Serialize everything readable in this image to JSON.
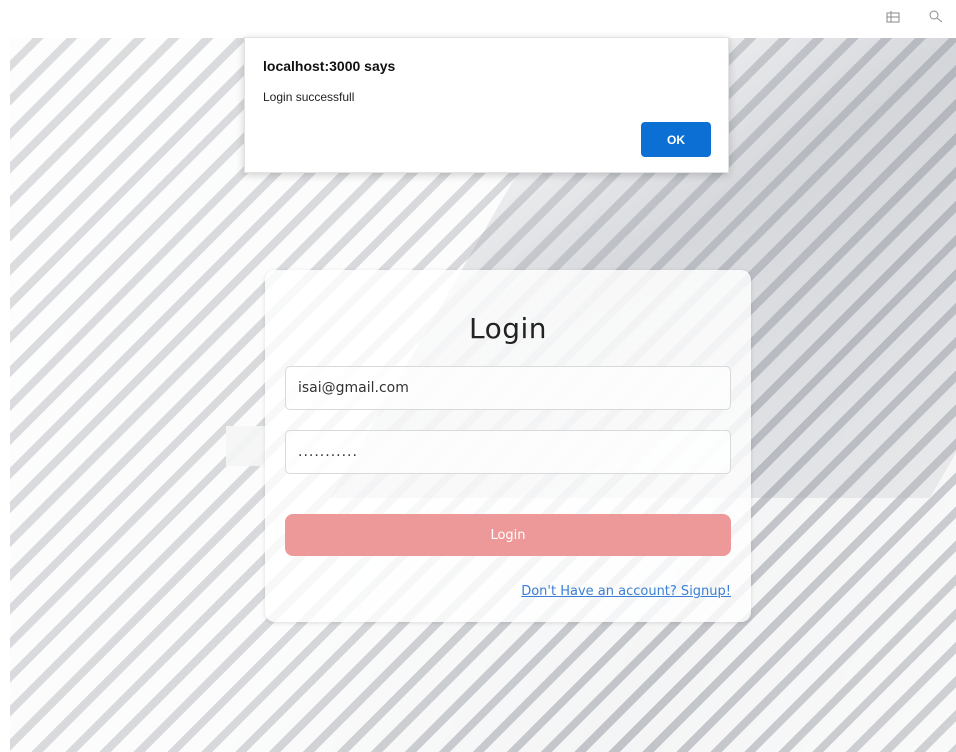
{
  "browser_toolbar": {
    "icons": [
      "grid-icon",
      "zoom-icon"
    ]
  },
  "login": {
    "title": "Login",
    "email_value": "isai@gmail.com",
    "password_mask": "...........",
    "button_label": "Login",
    "signup_link": "Don't Have an account? Signup!",
    "button_color": "#ee9999",
    "link_color": "#3a7fd5"
  },
  "alert": {
    "title": "localhost:3000 says",
    "message": "Login successfull",
    "ok_label": "OK",
    "ok_color": "#0b6fd4"
  }
}
